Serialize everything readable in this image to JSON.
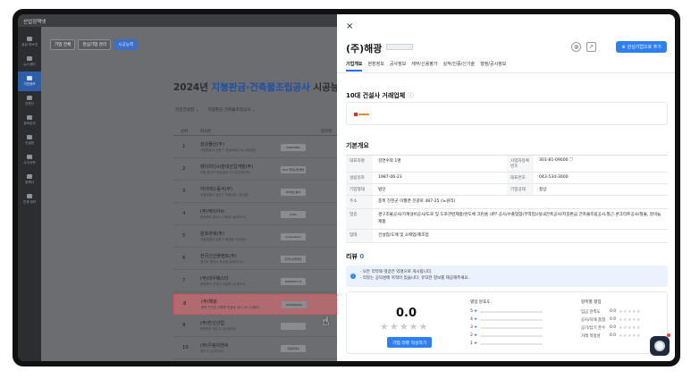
{
  "app": {
    "name": "산업정책넷"
  },
  "sidebar": {
    "items": [
      {
        "label": "공급 허브넷"
      },
      {
        "label": "뉴스센터"
      },
      {
        "label": "기업정보",
        "active": true
      },
      {
        "label": "전문인"
      },
      {
        "label": "정보분석"
      },
      {
        "label": "건설정"
      },
      {
        "label": "수주이력"
      },
      {
        "label": "정책서"
      },
      {
        "label": "인재 정보"
      }
    ]
  },
  "left": {
    "tabs": [
      "기업 전체",
      "관심기업 관리",
      "시공능력"
    ],
    "ranking_title_year": "2024년",
    "ranking_title_highlight": "지붕판금·건축물조립공사",
    "ranking_title_rest": "시공능력 순위",
    "filters": [
      "전문건설업",
      "지붕판금·건축물조립공사"
    ],
    "table_headers": [
      "순위",
      "회사명",
      "평가액"
    ],
    "rows": [
      {
        "num": "1",
        "name": "삼성물산(주)",
        "sub": "서울특별시 강동구 상일로6길 26 (상일동)",
        "logo": "SAMSUNG"
      },
      {
        "num": "2",
        "name": "에이치디씨현대산업개발(주)",
        "sub": "서울 용산구 한강대로 23 (한강로3가)",
        "logo": "HDC 현대산업개발"
      },
      {
        "num": "3",
        "name": "아이에스동서(주)",
        "sub": "서울특별시 강남구 영동대로 (삼성동)",
        "logo": "아이에스동서"
      },
      {
        "num": "4",
        "name": "(주)케이아씨",
        "sub": "충청북도 충주시 서측로 (상세주소)",
        "logo": "KYKC"
      },
      {
        "num": "5",
        "name": "원프라텍(주)",
        "sub": "서울특별시 송파구 중대로 (가락동)",
        "logo": "onepratech"
      },
      {
        "num": "6",
        "name": "한국신선플랜트(주)",
        "sub": "경기도 평택시 포승읍 (상세주소)",
        "logo": "한국신선플랜트"
      },
      {
        "num": "7",
        "name": "(주)대우패스티",
        "sub": "충청북도 진천군 이월면 (상세주소)",
        "logo": "DAEWOO ST"
      },
      {
        "num": "8",
        "name": "(주)해광",
        "sub": "충북 진천군 이월면 진광로 487-25 (노원리)",
        "logo": "HAEGWANG",
        "highlight": true
      },
      {
        "num": "9",
        "name": "(주)한신산업",
        "sub": "충청북도 청주시 (상세주소)",
        "logo": ""
      },
      {
        "num": "10",
        "name": "(주)우림이엔씨",
        "sub": "경기도 (상세주소)",
        "logo": "우림이엔씨"
      },
      {
        "num": "11",
        "name": "(주)시선개발",
        "sub": "충청북도 (상세주소)",
        "logo": "시선그룹"
      }
    ]
  },
  "detail": {
    "close": "×",
    "title": "(주)해광",
    "icons": [
      "globe-icon",
      "external-link-icon"
    ],
    "add_interest": "관심기업으로 추가",
    "tabs": [
      "기업개요",
      "현장정보",
      "공사정보",
      "재무/신용평가",
      "실적/인증/신기술",
      "행정/공시정보"
    ],
    "top10_title": "10대 건설사 거래업체",
    "top10_logo": "SK ecoplant",
    "basic_title": "기본개요",
    "info_rows": [
      {
        "k1": "대표자명",
        "v1": "김연수외 1명",
        "k2": "사업자등록번호",
        "v2": "301-81-09000"
      },
      {
        "k1": "설립일자",
        "v1": "1987-06-23",
        "k2": "대표번호",
        "v2": "043-534-3000"
      },
      {
        "k1": "기업형태",
        "v1": "법인",
        "k2": "기업상태",
        "v2": "정상"
      }
    ],
    "address_label": "주소",
    "address": "충북 진천군 이월면 진광로 487-25 (노원리)",
    "business_label": "업종",
    "business": "경구조물공사/가계설비공사/도로 및 도로관련제품/반도체 크린룸 내부 공사/수출업업(무역업)/실내건축공사/지붕판금.건축물조립공사,철근.콘크리트공사/철물, 알미늄제품",
    "industry_label": "업태",
    "industry": "건설업/도매 및 소매업/제조업",
    "review_title": "리뷰",
    "review_count": "0",
    "notice_line1": "모든 리뷰와 댓글은 익명으로 게시됩니다.",
    "notice_line2": "리뷰는 공익성에 목적이 있습니다. 유익한 정보를 제공해주세요.",
    "score": "0.0",
    "write_review": "기업 리뷰 작성하기",
    "dist_title": "별점 분포도",
    "dist_rows": [
      {
        "label": "5",
        "value": 0
      },
      {
        "label": "4",
        "value": 0
      },
      {
        "label": "3",
        "value": 0
      },
      {
        "label": "2",
        "value": 0
      },
      {
        "label": "1",
        "value": 0
      }
    ],
    "items_title": "항목별 평점",
    "items": [
      {
        "label": "임금 만족도",
        "value": "0.0"
      },
      {
        "label": "공사/자재 품질",
        "value": "0.0"
      },
      {
        "label": "공기/납기 준수",
        "value": "0.0"
      },
      {
        "label": "거래 적정성",
        "value": "0.0"
      }
    ]
  }
}
